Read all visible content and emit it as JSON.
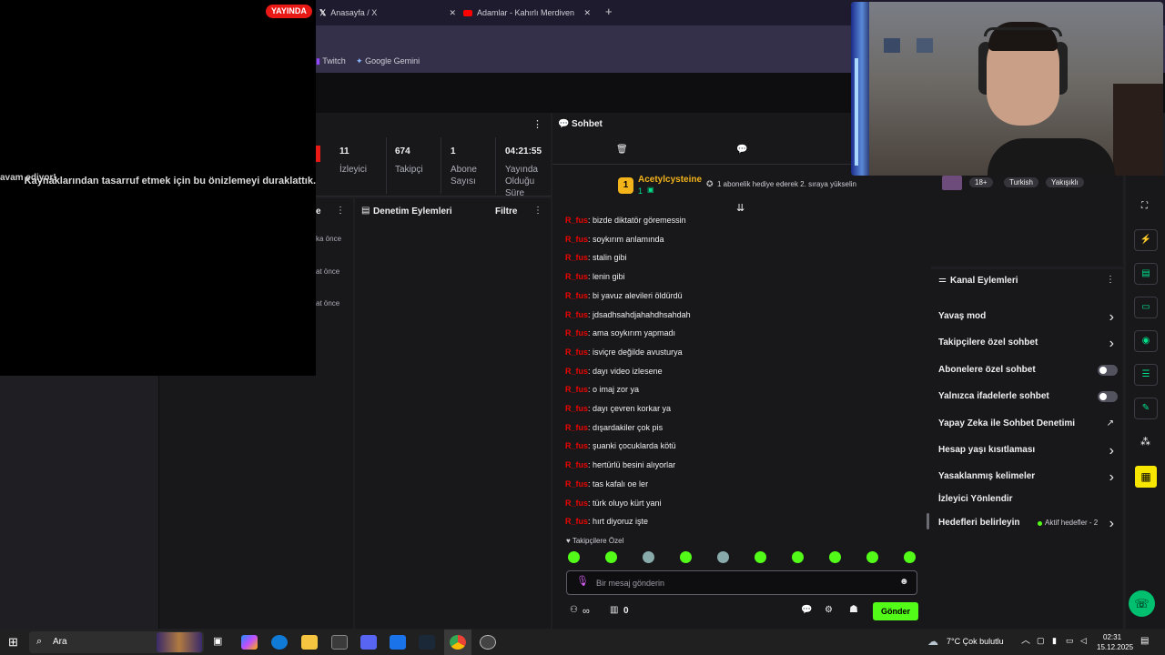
{
  "browser": {
    "tabs": [
      {
        "label": "Anasayfa / X",
        "icon": "x-logo-icon"
      },
      {
        "label": "Adamlar - Kahırlı Merdiven - Yo",
        "icon": "youtube-icon"
      }
    ],
    "bookmarks": [
      "Twitch",
      "Google Gemini"
    ]
  },
  "overlay": {
    "live_badge": "YAYINDA",
    "message": "Kaynaklarından tasarruf etmek için bu önizlemeyi duraklattık.",
    "ghost_text": "avam ediyor!"
  },
  "stats": [
    {
      "value": "11",
      "label": "İzleyici"
    },
    {
      "value": "674",
      "label": "Takipçi"
    },
    {
      "value": "1",
      "label": "Abone Sayısı"
    },
    {
      "value": "04:21:55",
      "label": "Yayında Olduğu Süre"
    }
  ],
  "side_panel": {
    "times": [
      "ka önce",
      "at önce",
      "at önce"
    ],
    "menu_char": "e"
  },
  "mod_panel": {
    "title": "Denetim Eylemleri",
    "filter": "Filtre"
  },
  "chat": {
    "title": "Sohbet",
    "pinned": {
      "rank": "1",
      "user": "Acetylcysteine",
      "count": "1",
      "text": "1 abonelik hediye ederek 2. sıraya yükselin"
    },
    "messages": [
      {
        "user": "R_fus",
        "text": "bizde diktatör göremessin"
      },
      {
        "user": "R_fus",
        "text": "soykırım anlamında"
      },
      {
        "user": "R_fus",
        "text": "stalin gibi"
      },
      {
        "user": "R_fus",
        "text": "lenin gibi"
      },
      {
        "user": "R_fus",
        "text": "bi yavuz alevileri öldürdü"
      },
      {
        "user": "R_fus",
        "text": "jdsadhsahdjahahdhsahdah"
      },
      {
        "user": "R_fus",
        "text": "ama soykırım yapmadı"
      },
      {
        "user": "R_fus",
        "text": "isviçre değilde avusturya"
      },
      {
        "user": "R_fus",
        "text": "dayı video izlesene"
      },
      {
        "user": "R_fus",
        "text": "o imaj zor ya"
      },
      {
        "user": "R_fus",
        "text": "dayı çevren korkar ya"
      },
      {
        "user": "R_fus",
        "text": "dışardakiler çok pis"
      },
      {
        "user": "R_fus",
        "text": "şuanki çocuklarda kötü"
      },
      {
        "user": "R_fus",
        "text": "hertürlü besini alıyorlar"
      },
      {
        "user": "R_fus",
        "text": "tas kafalı oe ler"
      },
      {
        "user": "R_fus",
        "text": "türk oluyo kürt yani"
      },
      {
        "user": "R_fus",
        "text": "hırt diyoruz işte"
      }
    ],
    "followers_only_label": "Takipçilere Özel",
    "input_placeholder": "Bir mesaj gönderin",
    "points": "∞",
    "gift_count": "0",
    "send_label": "Gönder"
  },
  "stream_tags": [
    "18+",
    "Turkish",
    "Yakışıklı"
  ],
  "channel_actions": {
    "title": "Kanal Eylemleri",
    "items": [
      {
        "label": "Yavaş mod",
        "control": "chevron"
      },
      {
        "label": "Takipçilere özel sohbet",
        "control": "chevron"
      },
      {
        "label": "Abonelere özel sohbet",
        "control": "toggle"
      },
      {
        "label": "Yalnızca ifadelerle sohbet",
        "control": "toggle"
      },
      {
        "label": "Yapay Zeka ile Sohbet Denetimi",
        "control": "external"
      },
      {
        "label": "Hesap yaşı kısıtlaması",
        "control": "chevron"
      },
      {
        "label": "Yasaklanmış kelimeler",
        "control": "chevron"
      },
      {
        "label": "İzleyici Yönlendir",
        "control": "none"
      },
      {
        "label": "Hedefleri belirleyin",
        "control": "chevron",
        "extra": "Aktif hedefler - 2"
      }
    ]
  },
  "taskbar": {
    "search": "Ara",
    "weather": "7°C  Çok bulutlu",
    "time": "02:31",
    "date": "15.12.2025"
  },
  "colors": {
    "accent": "#00e08a",
    "brand": "#53fc18",
    "live": "#e91916",
    "username": "#eb0400"
  }
}
